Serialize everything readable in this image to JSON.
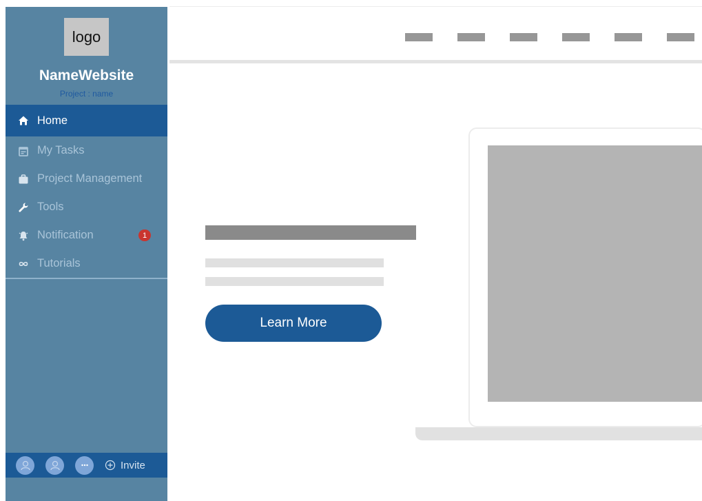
{
  "sidebar": {
    "logo_text": "logo",
    "site_name": "NameWebsite",
    "project_label": "Project : name",
    "nav_items": [
      {
        "label": "Home",
        "icon": "home-icon",
        "active": true
      },
      {
        "label": "My Tasks",
        "icon": "calendar-icon"
      },
      {
        "label": "Project Management",
        "icon": "briefcase-icon"
      },
      {
        "label": "Tools",
        "icon": "wrench-icon"
      },
      {
        "label": "Notification",
        "icon": "bell-icon",
        "badge": "1"
      },
      {
        "label": "Tutorials",
        "icon": "infinity-icon"
      }
    ],
    "footer": {
      "avatars": [
        "user-avatar-icon",
        "user-avatar-icon",
        "more-icon"
      ],
      "invite_label": "Invite"
    }
  },
  "hero": {
    "button_label": "Learn More"
  },
  "colors": {
    "sidebar_bg": "#5784a2",
    "accent": "#1c5a96",
    "badge": "#c9352f",
    "nav_text": "#a9c4d8"
  }
}
